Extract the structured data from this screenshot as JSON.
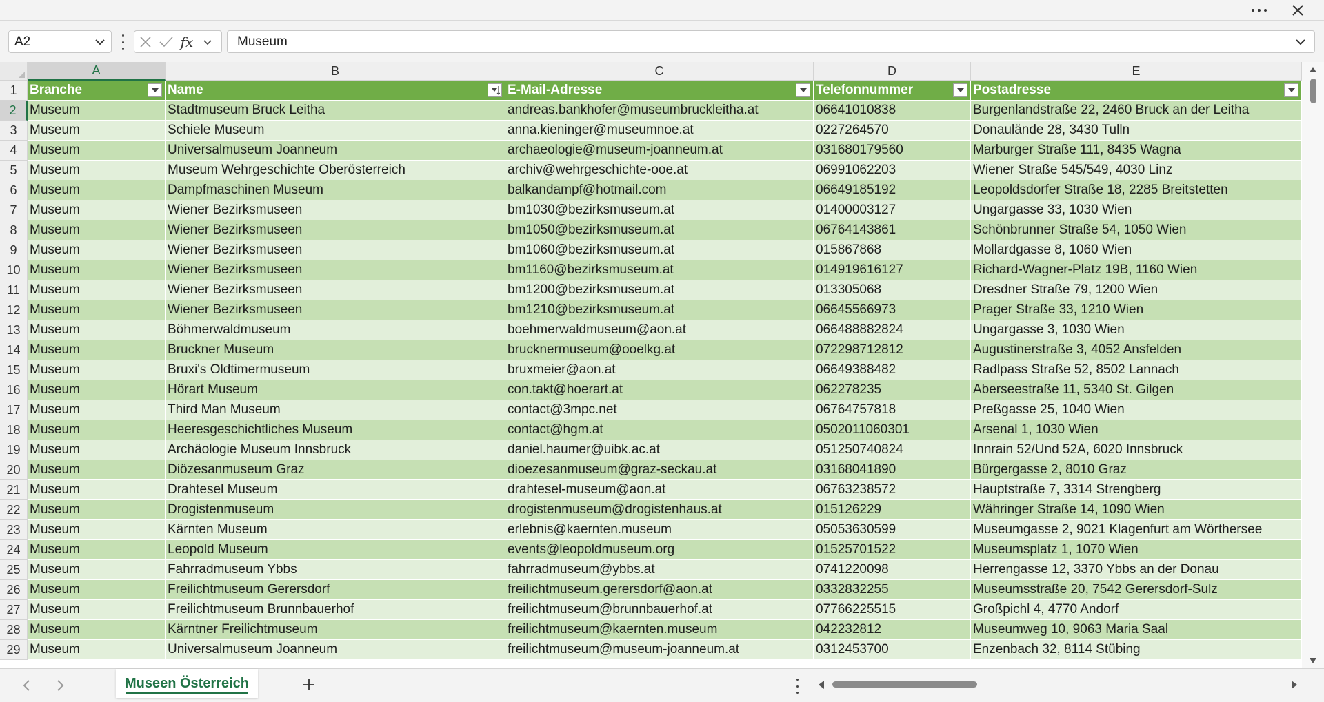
{
  "name_box": {
    "value": "A2"
  },
  "formula_bar": {
    "value": "Museum"
  },
  "columns": [
    "A",
    "B",
    "C",
    "D",
    "E"
  ],
  "header_row": {
    "row_number": "1",
    "cells": [
      "Branche",
      "Name",
      "E-Mail-Adresse",
      "Telefonnummer",
      "Postadresse"
    ]
  },
  "rows": [
    {
      "n": "2",
      "cells": [
        "Museum",
        "Stadtmuseum Bruck Leitha",
        "andreas.bankhofer@museumbruckleitha.at",
        "06641010838",
        "Burgenlandstraße 22, 2460 Bruck an der Leitha"
      ]
    },
    {
      "n": "3",
      "cells": [
        "Museum",
        "Schiele Museum",
        "anna.kieninger@museumnoe.at",
        "0227264570",
        "Donaulände 28, 3430 Tulln"
      ]
    },
    {
      "n": "4",
      "cells": [
        "Museum",
        "Universalmuseum Joanneum",
        "archaeologie@museum-joanneum.at",
        "031680179560",
        "Marburger Straße 111, 8435 Wagna"
      ]
    },
    {
      "n": "5",
      "cells": [
        "Museum",
        "Museum Wehrgeschichte Oberösterreich",
        "archiv@wehrgeschichte-ooe.at",
        "06991062203",
        "Wiener Straße 545/549, 4030 Linz"
      ]
    },
    {
      "n": "6",
      "cells": [
        "Museum",
        "Dampfmaschinen Museum",
        "balkandampf@hotmail.com",
        "06649185192",
        "Leopoldsdorfer Straße 18, 2285 Breitstetten"
      ]
    },
    {
      "n": "7",
      "cells": [
        "Museum",
        "Wiener Bezirksmuseen",
        "bm1030@bezirksmuseum.at",
        "01400003127",
        "Ungargasse 33, 1030 Wien"
      ]
    },
    {
      "n": "8",
      "cells": [
        "Museum",
        "Wiener Bezirksmuseen",
        "bm1050@bezirksmuseum.at",
        "06764143861",
        "Schönbrunner Straße 54, 1050 Wien"
      ]
    },
    {
      "n": "9",
      "cells": [
        "Museum",
        "Wiener Bezirksmuseen",
        "bm1060@bezirksmuseum.at",
        "015867868",
        "Mollardgasse 8, 1060 Wien"
      ]
    },
    {
      "n": "10",
      "cells": [
        "Museum",
        "Wiener Bezirksmuseen",
        "bm1160@bezirksmuseum.at",
        "014919616127",
        "Richard-Wagner-Platz 19B, 1160 Wien"
      ]
    },
    {
      "n": "11",
      "cells": [
        "Museum",
        "Wiener Bezirksmuseen",
        "bm1200@bezirksmuseum.at",
        "013305068",
        "Dresdner Straße 79, 1200 Wien"
      ]
    },
    {
      "n": "12",
      "cells": [
        "Museum",
        "Wiener Bezirksmuseen",
        "bm1210@bezirksmuseum.at",
        "06645566973",
        "Prager Straße 33, 1210 Wien"
      ]
    },
    {
      "n": "13",
      "cells": [
        "Museum",
        "Böhmerwaldmuseum",
        "boehmerwaldmuseum@aon.at",
        "066488882824",
        "Ungargasse 3, 1030 Wien"
      ]
    },
    {
      "n": "14",
      "cells": [
        "Museum",
        "Bruckner Museum",
        "brucknermuseum@ooelkg.at",
        "072298712812",
        "Augustinerstraße 3, 4052 Ansfelden"
      ]
    },
    {
      "n": "15",
      "cells": [
        "Museum",
        "Bruxi's Oldtimermuseum",
        "bruxmeier@aon.at",
        "06649388482",
        "Radlpass Straße 52, 8502 Lannach"
      ]
    },
    {
      "n": "16",
      "cells": [
        "Museum",
        "Hörart Museum",
        "con.takt@hoerart.at",
        "062278235",
        "Aberseestraße 11, 5340 St. Gilgen"
      ]
    },
    {
      "n": "17",
      "cells": [
        "Museum",
        "Third Man Museum",
        "contact@3mpc.net",
        "06764757818",
        "Preßgasse 25, 1040 Wien"
      ]
    },
    {
      "n": "18",
      "cells": [
        "Museum",
        "Heeresgeschichtliches Museum",
        "contact@hgm.at",
        "0502011060301",
        "Arsenal 1, 1030 Wien"
      ]
    },
    {
      "n": "19",
      "cells": [
        "Museum",
        "Archäologie Museum Innsbruck",
        "daniel.haumer@uibk.ac.at",
        "051250740824",
        "Innrain 52/Und 52A, 6020 Innsbruck"
      ]
    },
    {
      "n": "20",
      "cells": [
        "Museum",
        "Diözesanmuseum Graz",
        "dioezesanmuseum@graz-seckau.at",
        "03168041890",
        "Bürgergasse 2, 8010 Graz"
      ]
    },
    {
      "n": "21",
      "cells": [
        "Museum",
        "Drahtesel Museum",
        "drahtesel-museum@aon.at",
        "06763238572",
        "Hauptstraße 7, 3314 Strengberg"
      ]
    },
    {
      "n": "22",
      "cells": [
        "Museum",
        "Drogistenmuseum",
        "drogistenmuseum@drogistenhaus.at",
        "015126229",
        "Währinger Straße 14, 1090 Wien"
      ]
    },
    {
      "n": "23",
      "cells": [
        "Museum",
        "Kärnten Museum",
        "erlebnis@kaernten.museum",
        "05053630599",
        "Museumgasse 2, 9021 Klagenfurt am Wörthersee"
      ]
    },
    {
      "n": "24",
      "cells": [
        "Museum",
        "Leopold Museum",
        "events@leopoldmuseum.org",
        "01525701522",
        "Museumsplatz 1, 1070 Wien"
      ]
    },
    {
      "n": "25",
      "cells": [
        "Museum",
        "Fahrradmuseum Ybbs",
        "fahrradmuseum@ybbs.at",
        "0741220098",
        "Herrengasse 12, 3370 Ybbs an der Donau"
      ]
    },
    {
      "n": "26",
      "cells": [
        "Museum",
        "Freilichtmuseum Gerersdorf",
        "freilichtmuseum.gerersdorf@aon.at",
        "0332832255",
        "Museumsstraße 20, 7542 Gerersdorf-Sulz"
      ]
    },
    {
      "n": "27",
      "cells": [
        "Museum",
        "Freilichtmuseum Brunnbauerhof",
        "freilichtmuseum@brunnbauerhof.at",
        "07766225515",
        "Großpichl 4, 4770 Andorf"
      ]
    },
    {
      "n": "28",
      "cells": [
        "Museum",
        "Kärntner Freilichtmuseum",
        "freilichtmuseum@kaernten.museum",
        "042232812",
        "Museumweg 10, 9063 Maria Saal"
      ]
    },
    {
      "n": "29",
      "cells": [
        "Museum",
        "Universalmuseum Joanneum",
        "freilichtmuseum@museum-joanneum.at",
        "0312453700",
        "Enzenbach 32, 8114 Stübing"
      ]
    }
  ],
  "sheet_tab": {
    "label": "Museen Österreich"
  },
  "icons": {
    "more": "more-icon",
    "close": "close-icon",
    "cancel": "cancel-icon",
    "enter": "check-icon",
    "function": "fx-icon",
    "filter": "filter-dropdown-icon",
    "sort": "sort-icon",
    "add_sheet": "plus-icon"
  },
  "colors": {
    "header_fill": "#70ad47",
    "band_dark": "#c6e0b4",
    "band_light": "#e2efda",
    "accent": "#217346"
  }
}
